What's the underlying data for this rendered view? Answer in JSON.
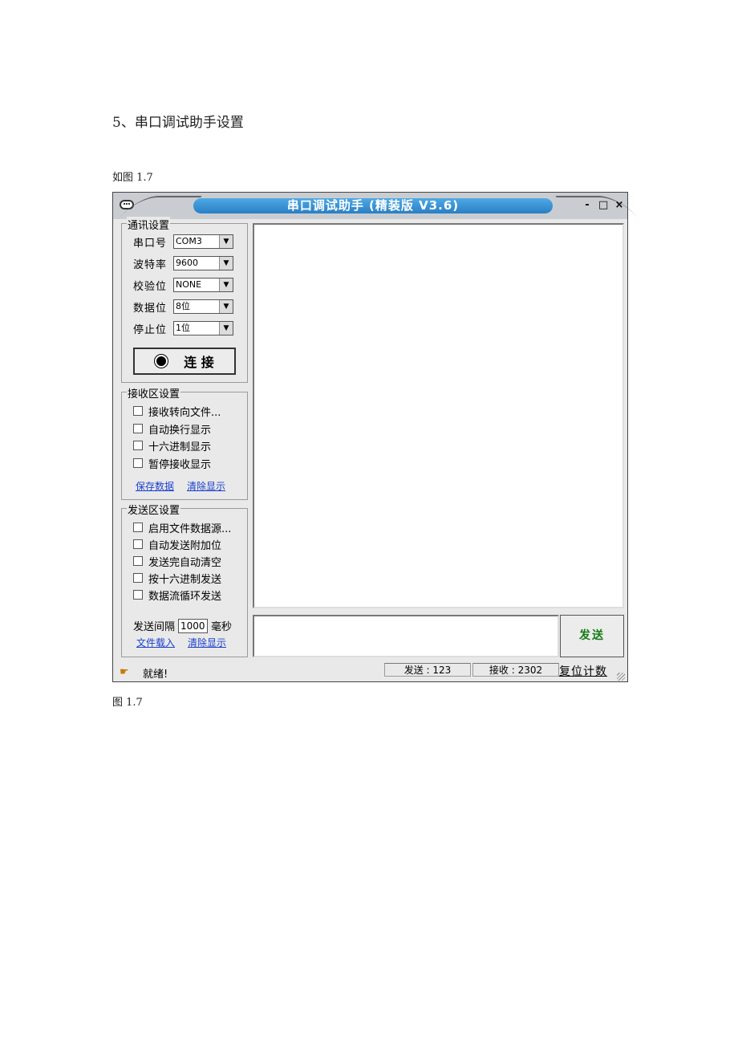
{
  "document": {
    "heading": "5、串口调试助手设置",
    "intro": "如图 1.7",
    "caption": "图 1.7"
  },
  "window": {
    "title": "串口调试助手 (精装版 V3.6)",
    "controls": {
      "minimize": "-",
      "maximize": "□",
      "close": "×"
    }
  },
  "comm_settings": {
    "title": "通讯设置",
    "fields": [
      {
        "label": "串口号",
        "value": "COM3"
      },
      {
        "label": "波特率",
        "value": "9600"
      },
      {
        "label": "校验位",
        "value": "NONE"
      },
      {
        "label": "数据位",
        "value": "8位"
      },
      {
        "label": "停止位",
        "value": "1位"
      }
    ],
    "connect_label": "连 接"
  },
  "recv_settings": {
    "title": "接收区设置",
    "options": [
      "接收转向文件...",
      "自动换行显示",
      "十六进制显示",
      "暂停接收显示"
    ],
    "links": {
      "save": "保存数据",
      "clear": "清除显示"
    }
  },
  "send_settings": {
    "title": "发送区设置",
    "options": [
      "启用文件数据源...",
      "自动发送附加位",
      "发送完自动清空",
      "按十六进制发送",
      "数据流循环发送"
    ],
    "interval_label": "发送间隔",
    "interval_value": "1000",
    "interval_unit": "毫秒",
    "links": {
      "load": "文件载入",
      "clear": "清除显示"
    }
  },
  "send_button": "发送",
  "status": {
    "text": "就绪!",
    "sent": "发送 : 123",
    "received": "接收 : 2302",
    "reset": "复位计数"
  },
  "colors": {
    "title_capsule": "#2a7fc4",
    "send_label": "#167a16",
    "link": "#1a3fd1"
  }
}
